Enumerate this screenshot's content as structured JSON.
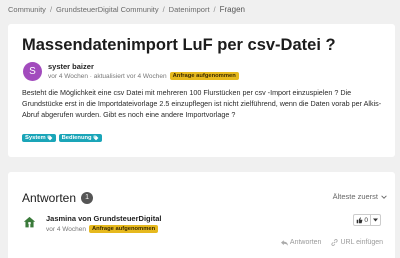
{
  "breadcrumb": {
    "items": [
      "Community",
      "GrundsteuerDigital Community",
      "Datenimport"
    ],
    "current": "Fragen",
    "separator": "/"
  },
  "topic": {
    "title": "Massendatenimport LuF per csv-Datei ?",
    "avatar_letter": "S",
    "author": "syster baizer",
    "meta": "vor 4 Wochen · aktualisiert vor 4 Wochen",
    "badge": "Anfrage aufgenommen",
    "body": "Besteht die Möglichkeit eine csv Datei mit mehreren 100 Flurstücken per csv -Import einzuspielen ? Die Grundstücke erst in die Importdateivorlage 2.5 einzupflegen ist nicht zielführend, wenn die Daten vorab per Alkis-Abruf abgerufen wurden. Gibt es noch eine andere Importvorlage ?",
    "tags": [
      "System",
      "Bedienung"
    ]
  },
  "answers": {
    "title": "Antworten",
    "count": "1",
    "sort_label": "Älteste zuerst",
    "item": {
      "author": "Jasmina von GrundsteuerDigital",
      "meta": "vor 4 Wochen",
      "badge": "Anfrage aufgenommen",
      "votes": "0",
      "reply_label": "Antworten",
      "copy_url_label": "URL einfügen"
    }
  },
  "colors": {
    "accent_badge": "#e6b91e",
    "tag": "#1aa5b8",
    "avatar": "#a24bbd"
  }
}
